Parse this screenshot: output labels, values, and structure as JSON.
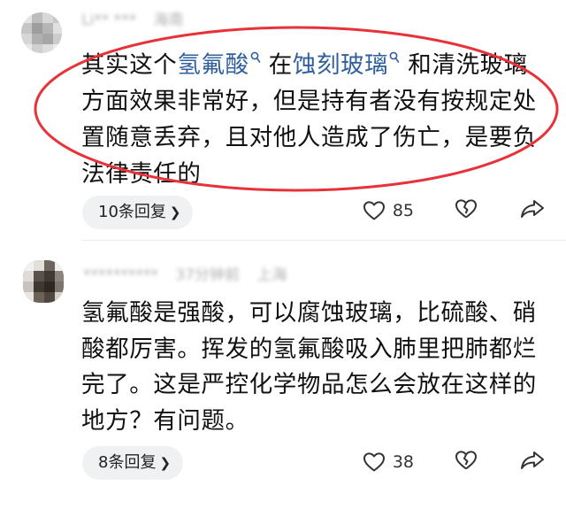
{
  "comments": [
    {
      "meta": {
        "name": "Li** ***",
        "time": "",
        "location": "海南"
      },
      "segments": [
        {
          "text": "其实这个",
          "kw": false
        },
        {
          "text": "氢氟酸",
          "kw": true
        },
        {
          "text": "在",
          "kw": false
        },
        {
          "text": "蚀刻玻璃",
          "kw": true
        },
        {
          "text": "和清洗玻璃方面效果非常好，但是持有者没有按规定处置随意丢弃，且对他人造成了伤亡，是要负法律责任的",
          "kw": false
        }
      ],
      "replies_label": "10条回复",
      "likes": "85"
    },
    {
      "meta": {
        "name": "**********",
        "time": "37分钟前",
        "location": "上海"
      },
      "text": "氢氟酸是强酸，可以腐蚀玻璃，比硫酸、硝酸都厉害。挥发的氢氟酸吸入肺里把肺都烂完了。这是严控化学物品怎么会放在这样的地方？有问题。",
      "replies_label": "8条回复",
      "likes": "38"
    }
  ],
  "icons": {
    "keyword": "search-icon",
    "reply_more": "chevron-right-icon",
    "like": "heart-icon",
    "dislike": "broken-heart-icon",
    "share": "share-arrow-icon"
  },
  "colors": {
    "keyword": "#2f5f9e",
    "highlight_oval": "#e8323a",
    "reply_button_bg": "#f0f1f3"
  }
}
